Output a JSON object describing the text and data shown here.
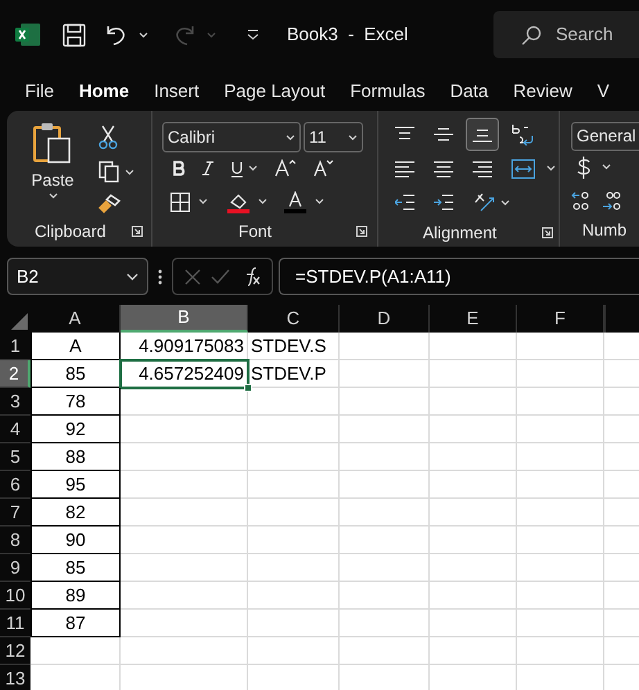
{
  "title_bar": {
    "title": "Book3  -  Excel",
    "search_placeholder": "Search"
  },
  "tabs": [
    {
      "label": "File",
      "selected": false
    },
    {
      "label": "Home",
      "selected": true
    },
    {
      "label": "Insert",
      "selected": false
    },
    {
      "label": "Page Layout",
      "selected": false
    },
    {
      "label": "Formulas",
      "selected": false
    },
    {
      "label": "Data",
      "selected": false
    },
    {
      "label": "Review",
      "selected": false
    },
    {
      "label": "V",
      "selected": false
    }
  ],
  "ribbon": {
    "clipboard": {
      "paste_label": "Paste",
      "group_label": "Clipboard"
    },
    "font": {
      "font_name": "Calibri",
      "font_size": "11",
      "group_label": "Font"
    },
    "alignment": {
      "group_label": "Alignment"
    },
    "number": {
      "format": "General",
      "group_label": "Numb"
    }
  },
  "formula_bar": {
    "name_box": "B2",
    "formula": "=STDEV.P(A1:A11)"
  },
  "grid": {
    "columns": [
      {
        "label": "A",
        "selected": false
      },
      {
        "label": "B",
        "selected": true
      },
      {
        "label": "C",
        "selected": false
      },
      {
        "label": "D",
        "selected": false
      },
      {
        "label": "E",
        "selected": false
      },
      {
        "label": "F",
        "selected": false
      }
    ],
    "rows": [
      {
        "header": "1",
        "selected": false,
        "cells": [
          "A",
          "4.909175083",
          "STDEV.S"
        ]
      },
      {
        "header": "2",
        "selected": true,
        "cells": [
          "85",
          "4.657252409",
          "STDEV.P"
        ]
      },
      {
        "header": "3",
        "selected": false,
        "cells": [
          "78"
        ]
      },
      {
        "header": "4",
        "selected": false,
        "cells": [
          "92"
        ]
      },
      {
        "header": "5",
        "selected": false,
        "cells": [
          "88"
        ]
      },
      {
        "header": "6",
        "selected": false,
        "cells": [
          "95"
        ]
      },
      {
        "header": "7",
        "selected": false,
        "cells": [
          "82"
        ]
      },
      {
        "header": "8",
        "selected": false,
        "cells": [
          "90"
        ]
      },
      {
        "header": "9",
        "selected": false,
        "cells": [
          "85"
        ]
      },
      {
        "header": "10",
        "selected": false,
        "cells": [
          "89"
        ]
      },
      {
        "header": "11",
        "selected": false,
        "cells": [
          "87"
        ]
      },
      {
        "header": "12",
        "selected": false,
        "cells": []
      },
      {
        "header": "13",
        "selected": false,
        "cells": []
      }
    ]
  }
}
